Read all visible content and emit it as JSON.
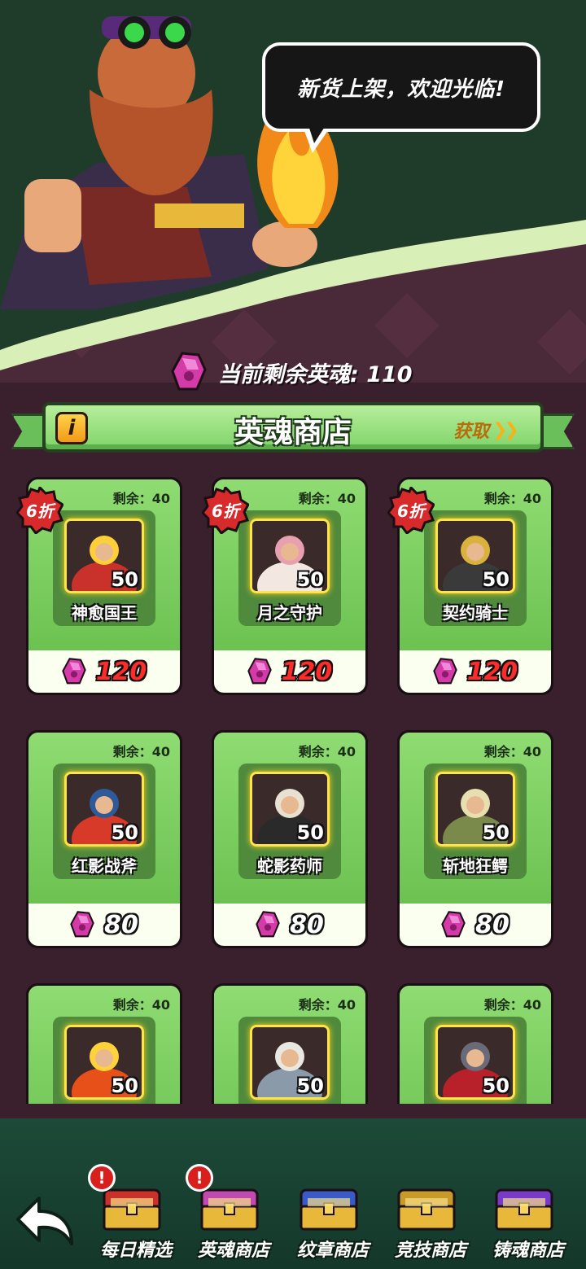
{
  "merchant": {
    "greeting": "新货上架，欢迎光临!"
  },
  "currency": {
    "label": "当前剩余英魂: 110",
    "icon": "soul-gem-icon"
  },
  "shop": {
    "title": "英魂商店",
    "info_label": "i",
    "obtain_label": "获取",
    "obtain_icon": "double-chevron-right-icon"
  },
  "items": [
    {
      "name": "神愈国王",
      "stock": "剩余：40",
      "count": "50",
      "price": "120",
      "discount": "6折",
      "on_sale": true,
      "art_color": "#c8322a",
      "art_accent": "#ffcf3a"
    },
    {
      "name": "月之守护",
      "stock": "剩余：40",
      "count": "50",
      "price": "120",
      "discount": "6折",
      "on_sale": true,
      "art_color": "#f3e7e2",
      "art_accent": "#e8a0b0"
    },
    {
      "name": "契约骑士",
      "stock": "剩余：40",
      "count": "50",
      "price": "120",
      "discount": "6折",
      "on_sale": true,
      "art_color": "#3a3a3a",
      "art_accent": "#d8b23a"
    },
    {
      "name": "红影战斧",
      "stock": "剩余：40",
      "count": "50",
      "price": "80",
      "discount": "",
      "on_sale": false,
      "art_color": "#d83a2a",
      "art_accent": "#2f5a9a"
    },
    {
      "name": "蛇影药师",
      "stock": "剩余：40",
      "count": "50",
      "price": "80",
      "discount": "",
      "on_sale": false,
      "art_color": "#2a2a2a",
      "art_accent": "#e8e0d0"
    },
    {
      "name": "斩地狂鳄",
      "stock": "剩余：40",
      "count": "50",
      "price": "80",
      "discount": "",
      "on_sale": false,
      "art_color": "#7a8a4a",
      "art_accent": "#e8dfb0"
    },
    {
      "name": "",
      "stock": "剩余：40",
      "count": "50",
      "price": "",
      "discount": "",
      "on_sale": false,
      "art_color": "#e8501a",
      "art_accent": "#ffd23a"
    },
    {
      "name": "",
      "stock": "剩余：40",
      "count": "50",
      "price": "",
      "discount": "",
      "on_sale": false,
      "art_color": "#8a9aa8",
      "art_accent": "#e8e8e0"
    },
    {
      "name": "",
      "stock": "剩余：40",
      "count": "50",
      "price": "",
      "discount": "",
      "on_sale": false,
      "art_color": "#b8202a",
      "art_accent": "#6a6a78"
    }
  ],
  "nav": {
    "back_icon": "back-arrow-icon",
    "tabs": [
      {
        "label": "每日精选",
        "alert": "!",
        "icon": "red-chest-icon",
        "chest_color": "#c8322a"
      },
      {
        "label": "英魂商店",
        "alert": "!",
        "icon": "pink-chest-icon",
        "chest_color": "#c04ab0"
      },
      {
        "label": "纹章商店",
        "alert": "",
        "icon": "blue-chest-icon",
        "chest_color": "#3a5ac8"
      },
      {
        "label": "竞技商店",
        "alert": "",
        "icon": "gold-chest-icon",
        "chest_color": "#c89a2a"
      },
      {
        "label": "铸魂商店",
        "alert": "",
        "icon": "purple-chest-icon",
        "chest_color": "#7a3ac8"
      }
    ]
  },
  "colors": {
    "soul_gem": "#d43aa8",
    "sale_price": "#ff2a2a",
    "card_green": "#7ccf60",
    "page_bg": "#3a1f2c"
  }
}
